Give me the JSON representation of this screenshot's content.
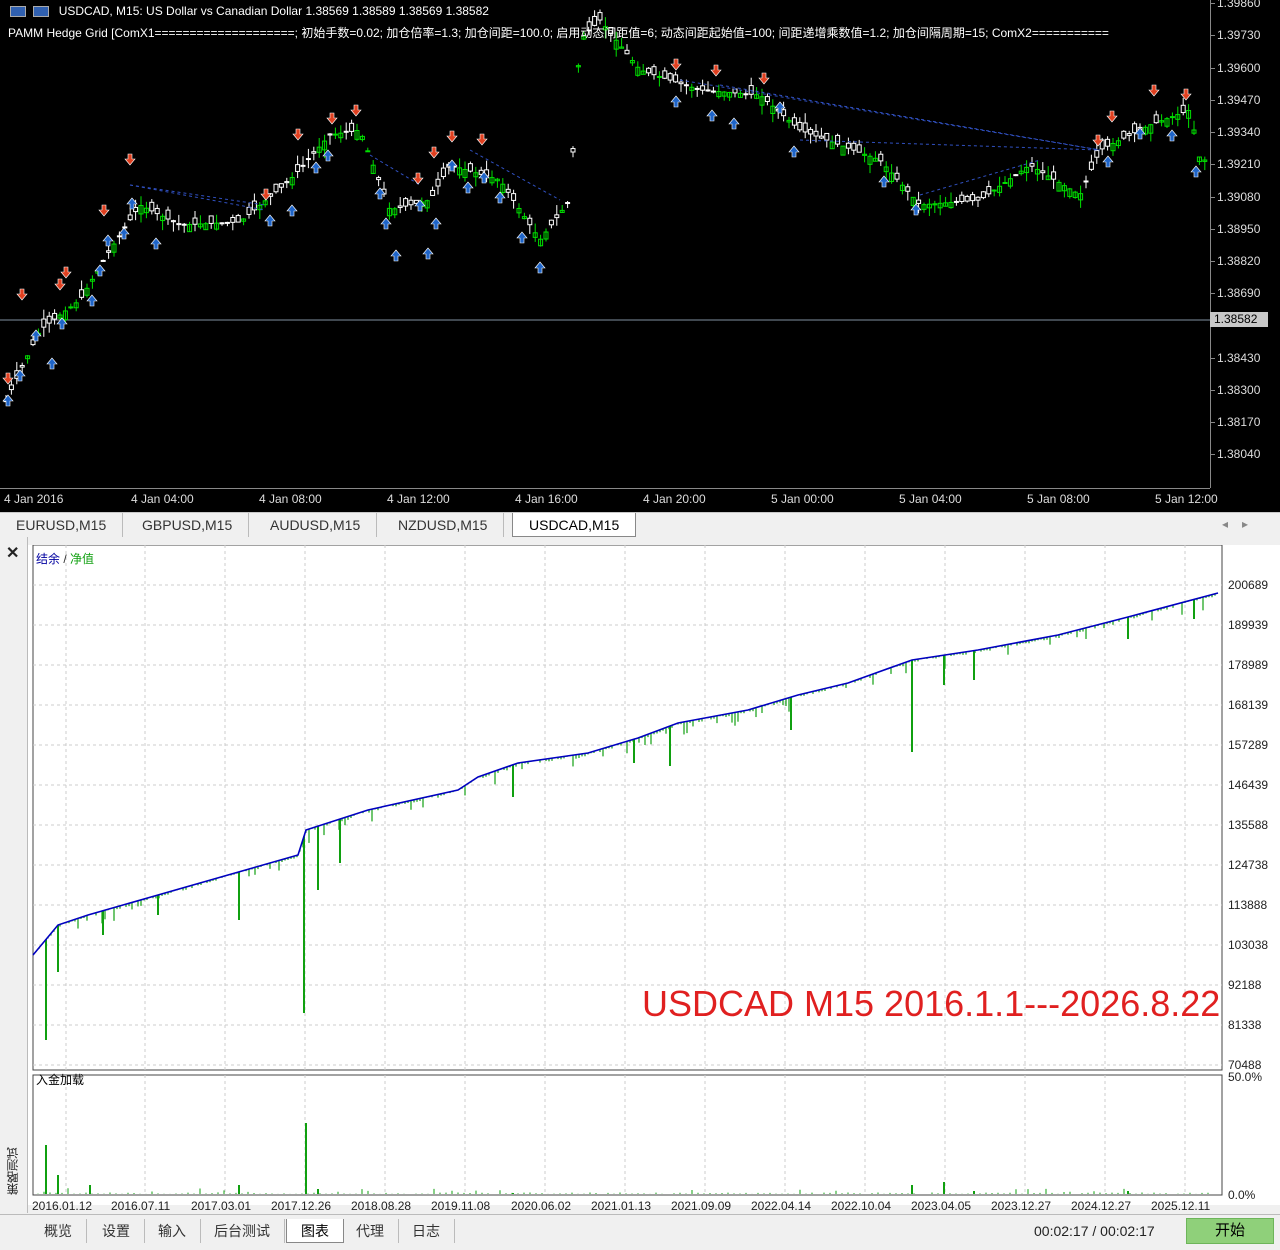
{
  "chart": {
    "title_line": "USDCAD, M15:  US Dollar vs Canadian Dollar  1.38569 1.38589 1.38569 1.38582",
    "indicator_line": "PAMM Hedge Grid [ComX1====================; 初始手数=0.02; 加仓倍率=1.3; 加仓间距=100.0; 启用动态间距值=6; 动态间距起始值=100; 间距递增乘数值=1.2; 加仓间隔周期=15; ComX2===========",
    "current_price": "1.38582",
    "price_ticks": [
      "1.39860",
      "1.39730",
      "1.39600",
      "1.39470",
      "1.39340",
      "1.39210",
      "1.39080",
      "1.38950",
      "1.38820",
      "1.38690",
      "1.38430",
      "1.38300",
      "1.38170",
      "1.38040"
    ],
    "time_ticks": [
      "4 Jan 2016",
      "4 Jan 04:00",
      "4 Jan 08:00",
      "4 Jan 12:00",
      "4 Jan 16:00",
      "4 Jan 20:00",
      "5 Jan 00:00",
      "5 Jan 04:00",
      "5 Jan 08:00",
      "5 Jan 12:00"
    ],
    "bull_color": "#00e000",
    "bear_color": "#ffffff",
    "buy_arrow_color": "#1e64c8",
    "sell_arrow_color": "#e04020"
  },
  "symbol_tabs": [
    "EURUSD,M15",
    "GBPUSD,M15",
    "AUDUSD,M15",
    "NZDUSD,M15",
    "USDCAD,M15"
  ],
  "active_symbol_tab": "USDCAD,M15",
  "tester": {
    "side_label": "策略测试",
    "legend_balance": "结余",
    "legend_sep": "/",
    "legend_equity": "净值",
    "watermark": "USDCAD M15 2016.1.1---2026.8.22",
    "deposit_load_label": "入金加载",
    "y_ticks": [
      "200689",
      "189939",
      "178989",
      "168139",
      "157289",
      "146439",
      "135588",
      "124738",
      "113888",
      "103038",
      "92188",
      "81338",
      "70488"
    ],
    "load_ticks": [
      "50.0%",
      "0.0%"
    ],
    "date_ticks": [
      "2016.01.12",
      "2016.07.11",
      "2017.03.01",
      "2017.12.26",
      "2018.08.28",
      "2019.11.08",
      "2020.06.02",
      "2021.01.13",
      "2021.09.09",
      "2022.04.14",
      "2022.10.04",
      "2023.04.05",
      "2023.12.27",
      "2024.12.27",
      "2025.12.11"
    ],
    "balance_color": "#0000c0",
    "equity_color": "#10a010"
  },
  "bottom_tabs": [
    "概览",
    "设置",
    "输入",
    "后台测试",
    "图表",
    "代理",
    "日志"
  ],
  "active_bottom_tab": "图表",
  "timer": "00:02:17 / 00:02:17",
  "start_label": "开始"
}
